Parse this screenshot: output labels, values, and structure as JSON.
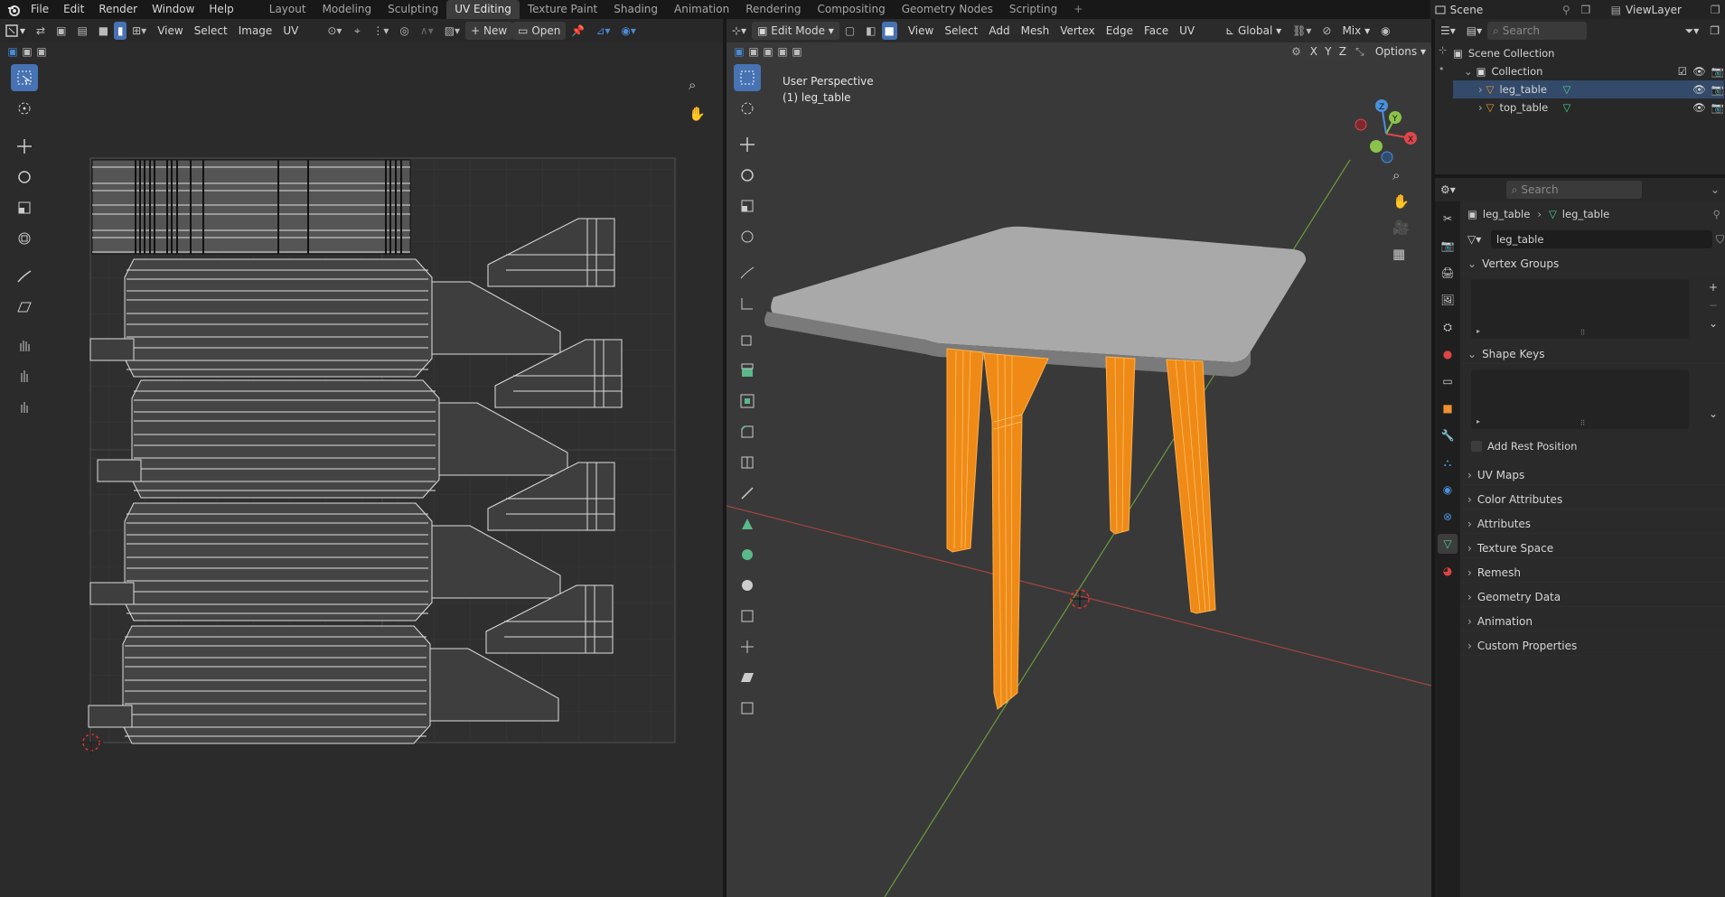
{
  "topbar": {
    "menus": [
      "File",
      "Edit",
      "Render",
      "Window",
      "Help"
    ],
    "workspaces": [
      "Layout",
      "Modeling",
      "Sculpting",
      "UV Editing",
      "Texture Paint",
      "Shading",
      "Animation",
      "Rendering",
      "Compositing",
      "Geometry Nodes",
      "Scripting"
    ],
    "active_workspace": "UV Editing",
    "scene": "Scene",
    "view_layer": "ViewLayer"
  },
  "uv_editor": {
    "menus": [
      "View",
      "Select",
      "Image",
      "UV"
    ],
    "new_label": "New",
    "open_label": "Open"
  },
  "viewport": {
    "mode": "Edit Mode",
    "menus": [
      "View",
      "Select",
      "Add",
      "Mesh",
      "Vertex",
      "Edge",
      "Face",
      "UV"
    ],
    "orientation": "Global",
    "mix": "Mix",
    "axes": [
      "X",
      "Y",
      "Z"
    ],
    "options_label": "Options",
    "overlay_title": "User Perspective",
    "overlay_object": "(1) leg_table",
    "gizmo": {
      "x": "X",
      "y": "Y",
      "z": "Z"
    }
  },
  "outliner": {
    "search_placeholder": "Search",
    "root": "Scene Collection",
    "collection": "Collection",
    "objects": [
      "leg_table",
      "top_table"
    ]
  },
  "properties": {
    "search_placeholder": "Search",
    "breadcrumb_object": "leg_table",
    "breadcrumb_data": "leg_table",
    "data_name": "leg_table",
    "vertex_groups": "Vertex Groups",
    "shape_keys": "Shape Keys",
    "add_rest_position": "Add Rest Position",
    "sections": [
      "UV Maps",
      "Color Attributes",
      "Attributes",
      "Texture Space",
      "Remesh",
      "Geometry Data",
      "Animation",
      "Custom Properties"
    ]
  },
  "colors": {
    "accent": "#4772b3",
    "selection": "#ff8c1a",
    "bg": "#1d1d1d",
    "header": "#282828"
  }
}
